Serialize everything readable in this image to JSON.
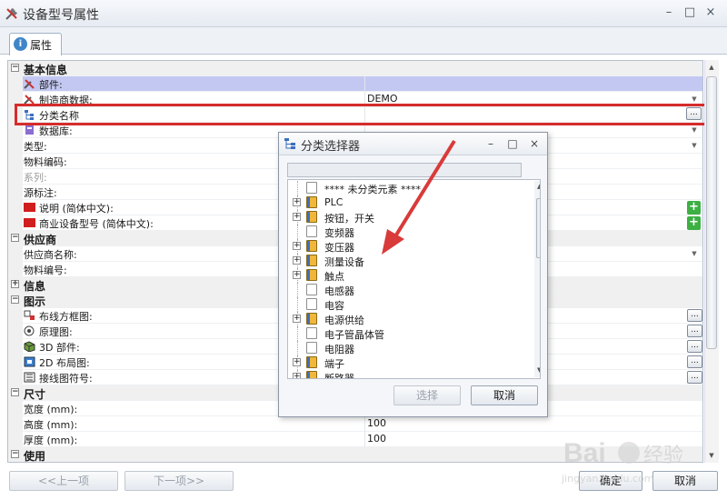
{
  "window": {
    "title": "设备型号属性",
    "minimize_label": "–",
    "maximize_label": "□",
    "close_label": "×"
  },
  "tabs": [
    {
      "label": "属性",
      "icon": "info-icon"
    }
  ],
  "grid": {
    "sections": [
      {
        "label": "基本信息",
        "expanded": true
      },
      {
        "label": "供应商",
        "expanded": true
      },
      {
        "label": "信息",
        "expanded": false
      },
      {
        "label": "图示",
        "expanded": true
      },
      {
        "label": "尺寸",
        "expanded": true
      },
      {
        "label": "使用",
        "expanded": true
      }
    ],
    "basic_rows": [
      {
        "name": "部件:",
        "value": ""
      },
      {
        "name": "制造商数据:",
        "value": "DEMO"
      },
      {
        "name": "分类名称",
        "value": ""
      },
      {
        "name": "数据库:",
        "value": ""
      },
      {
        "name": "类型:",
        "value": ""
      },
      {
        "name": "物料编码:",
        "value": ""
      },
      {
        "name": "系列:",
        "value": ""
      },
      {
        "name": "源标注:",
        "value": ""
      },
      {
        "name": "说明 (简体中文):",
        "value": ""
      },
      {
        "name": "商业设备型号 (简体中文):",
        "value": ""
      }
    ],
    "supplier_rows": [
      {
        "name": "供应商名称:",
        "value": ""
      },
      {
        "name": "物料编号:",
        "value": ""
      }
    ],
    "graphic_rows": [
      {
        "name": "布线方框图:",
        "value": ""
      },
      {
        "name": "原理图:",
        "value": ""
      },
      {
        "name": "3D 部件:",
        "value": ""
      },
      {
        "name": "2D 布局图:",
        "value": ""
      },
      {
        "name": "接线图符号:",
        "value": ""
      }
    ],
    "size_rows": [
      {
        "name": "宽度 (mm):",
        "value": ""
      },
      {
        "name": "高度 (mm):",
        "value": "100"
      },
      {
        "name": "厚度 (mm):",
        "value": "100"
      }
    ],
    "ellipsis_label": "...",
    "add_label": "+"
  },
  "dialog": {
    "title": "分类选择器",
    "minimize_label": "–",
    "maximize_label": "□",
    "close_label": "×",
    "filter_value": "",
    "tree": [
      {
        "label": "**** 未分类元素 ****",
        "expandable": false,
        "icon": "page"
      },
      {
        "label": "PLC",
        "expandable": true,
        "icon": "book"
      },
      {
        "label": "按钮，开关",
        "expandable": true,
        "icon": "book"
      },
      {
        "label": "变频器",
        "expandable": false,
        "icon": "page"
      },
      {
        "label": "变压器",
        "expandable": true,
        "icon": "book"
      },
      {
        "label": "测量设备",
        "expandable": true,
        "icon": "book"
      },
      {
        "label": "触点",
        "expandable": true,
        "icon": "book"
      },
      {
        "label": "电感器",
        "expandable": false,
        "icon": "page"
      },
      {
        "label": "电容",
        "expandable": false,
        "icon": "page"
      },
      {
        "label": "电源供给",
        "expandable": true,
        "icon": "book"
      },
      {
        "label": "电子管晶体管",
        "expandable": false,
        "icon": "page"
      },
      {
        "label": "电阻器",
        "expandable": false,
        "icon": "page"
      },
      {
        "label": "端子",
        "expandable": true,
        "icon": "book"
      },
      {
        "label": "断路器",
        "expandable": true,
        "icon": "book"
      }
    ],
    "select_label": "选择",
    "cancel_label": "取消"
  },
  "footer": {
    "prev_label": "<<上一项",
    "next_label": "下一项>>",
    "ok_label": "确定",
    "cancel_label": "取消"
  },
  "colors": {
    "highlight_box": "#d62c2c",
    "arrow": "#d93a3a",
    "selected_row": "#c3c8f2"
  }
}
